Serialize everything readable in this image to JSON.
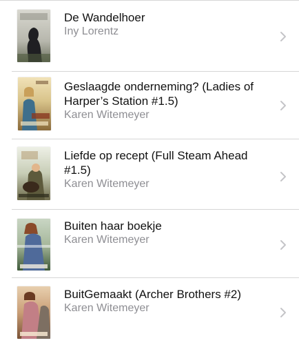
{
  "colors": {
    "title": "#111111",
    "author": "#8e8e93",
    "separator": "#d6d6d6",
    "chevron": "#c4c4c7"
  },
  "books": [
    {
      "title": "De Wandelhoer",
      "author": "Iny Lorentz",
      "cover_icon": "book-cover-de-wandelhoer",
      "chevron_icon": "chevron-right-icon"
    },
    {
      "title": "Geslaagde onderneming? (Ladies of Harper’s Station #1.5)",
      "author": "Karen Witemeyer",
      "cover_icon": "book-cover-geslaagde-onderneming",
      "chevron_icon": "chevron-right-icon"
    },
    {
      "title": "Liefde op recept (Full Steam Ahead #1.5)",
      "author": "Karen Witemeyer",
      "cover_icon": "book-cover-liefde-op-recept",
      "chevron_icon": "chevron-right-icon"
    },
    {
      "title": "Buiten haar boekje",
      "author": "Karen Witemeyer",
      "cover_icon": "book-cover-buiten-haar-boekje",
      "chevron_icon": "chevron-right-icon"
    },
    {
      "title": "BuitGemaakt (Archer Brothers #2)",
      "author": "Karen Witemeyer",
      "cover_icon": "book-cover-buitgemaakt",
      "chevron_icon": "chevron-right-icon"
    }
  ]
}
